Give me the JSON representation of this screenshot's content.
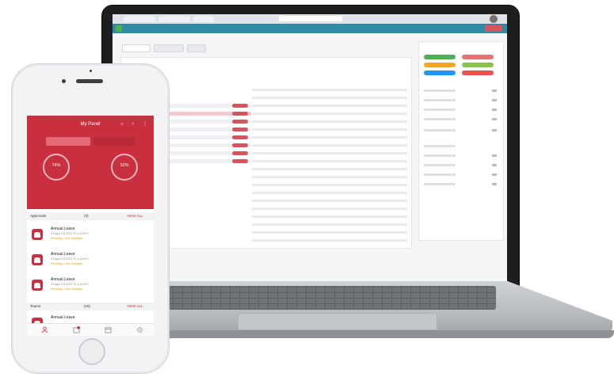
{
  "colors": {
    "brand_red": "#c8303f",
    "browser_nav": "#2e8ba3",
    "pending": "#e0a000"
  },
  "laptop": {
    "chips": [
      {
        "color": "#4caf50"
      },
      {
        "color": "#e57373"
      },
      {
        "color": "#f5a623"
      },
      {
        "color": "#8bc34a"
      },
      {
        "color": "#2196f3"
      },
      {
        "color": "#ef5350"
      }
    ]
  },
  "phone": {
    "header_title": "My Panel",
    "ring_left": "74%",
    "ring_right": "32%",
    "section_approvals": {
      "label": "Approvals",
      "count": "(3)",
      "link": "VIEW ALL"
    },
    "leaves": [
      {
        "title": "Annual Leave",
        "dates": "2 Days   2.5.2017 To 3.5.2017",
        "status": "Pending - Line Manager"
      },
      {
        "title": "Annual Leave",
        "dates": "2 Days   2.5.2017 To 3.5.2017",
        "status": "Pending - Line Manager"
      },
      {
        "title": "Annual Leave",
        "dates": "2 Days   2.5.2017 To 3.5.2017",
        "status": "Pending - Line Manager"
      }
    ],
    "section_teams": {
      "label": "Teams",
      "count": "(15)",
      "link": "VIEW ALL"
    },
    "last_leave_title": "Annual Leave",
    "tab_icons": [
      "people-icon",
      "inbox-icon",
      "calendar-icon",
      "settings-icon"
    ]
  }
}
